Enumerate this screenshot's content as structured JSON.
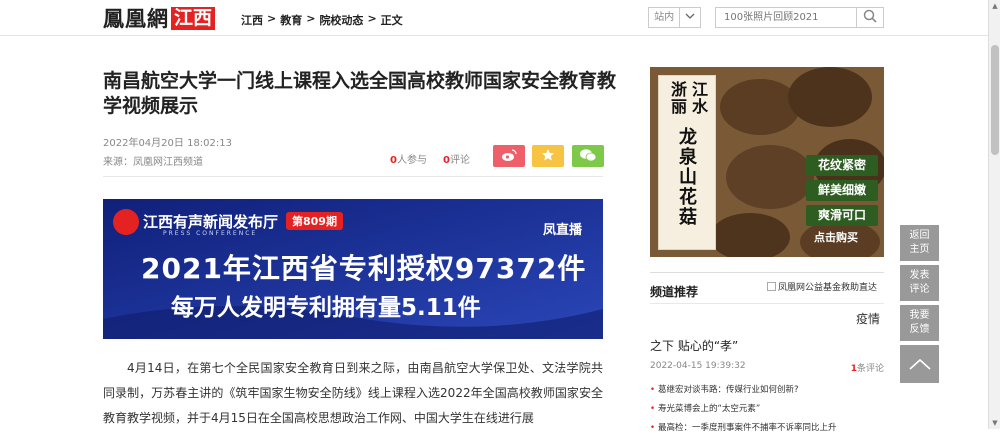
{
  "header": {
    "logo_text": "鳳凰網",
    "logo_region": "江西",
    "breadcrumb": [
      "江西",
      ">",
      "教育",
      ">",
      "院校动态",
      ">",
      "正文"
    ],
    "site_select": "站内",
    "search_placeholder": "100张照片回顾2021"
  },
  "article": {
    "title": "南昌航空大学一门线上课程入选全国高校教师国家安全教育教学视频展示",
    "date": "2022年04月20日 18:02:13",
    "source": "来源：凤凰网江西频道",
    "participants_count": "0",
    "participants_label": "人参与",
    "comments_count": "0",
    "comments_label": "评论",
    "banner": {
      "brand": "江西有声新闻发布厅",
      "brand_en": "PRESS CONFERENCE",
      "issue": "第809期",
      "live": "凤直播",
      "line1": "2021年江西省专利授权97372件",
      "line2": "每万人发明专利拥有量5.11件"
    },
    "body": "4月14日，在第七个全民国家安全教育日到来之际，由南昌航空大学保卫处、文法学院共同录制，万苏春主讲的《筑牢国家生物安全防线》线上课程入选2022年全国高校教师国家安全教育教学视频，并于4月15日在全国高校思想政治工作网、中国大学生在线进行展"
  },
  "ad": {
    "col1": "浙丽",
    "col2": "江水",
    "col3": "龙泉山花菇",
    "tags": [
      "花纹紧密",
      "鲜美细嫩",
      "爽滑可口"
    ],
    "buy": "点击购买"
  },
  "recommend": {
    "title": "频道推荐",
    "img_alt": "凤凰网公益基金救助直达",
    "tag": "疫情",
    "headline": "之下 贴心的“孝”",
    "date": "2022-04-15 19:39:32",
    "comment_count": "1",
    "comment_label": "条评论",
    "items": [
      "葛继宏对谈韦路：传媒行业如何创新?",
      "寿光菜博会上的“太空元素”",
      "最高检：一季度刑事案件不捕率不诉率同比上升"
    ]
  },
  "side": {
    "back_home": [
      "返回",
      "主页"
    ],
    "post_comment": [
      "发表",
      "评论"
    ],
    "feedback": [
      "我要",
      "反馈"
    ]
  }
}
